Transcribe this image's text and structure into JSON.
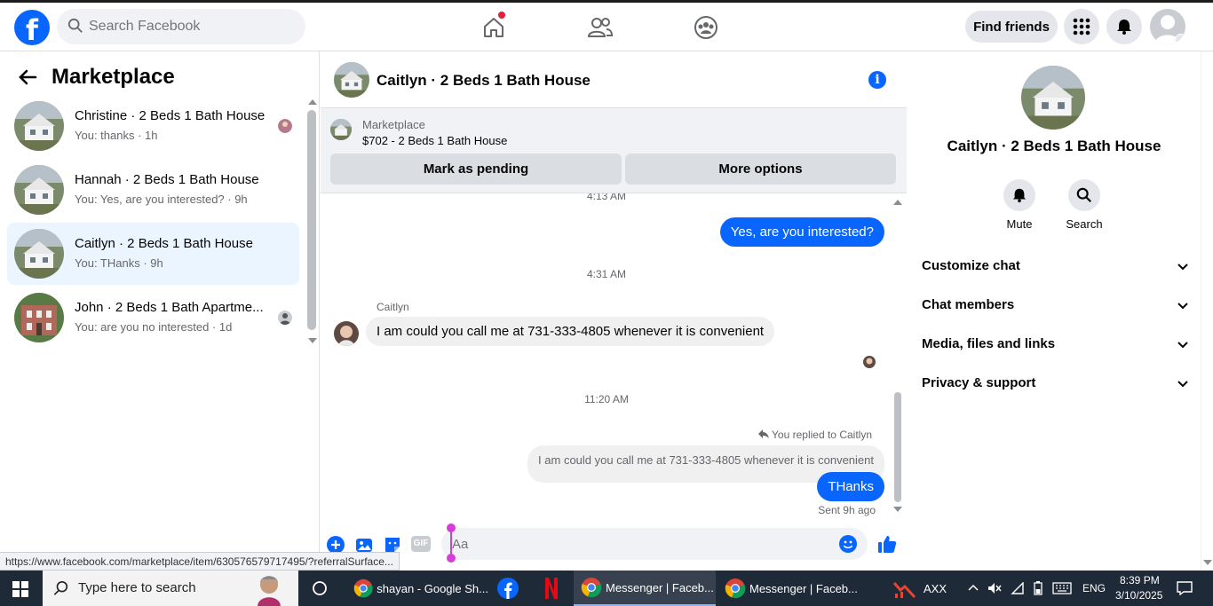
{
  "topbar": {
    "logo_letter": "f",
    "search_placeholder": "Search Facebook",
    "find_friends_label": "Find friends"
  },
  "left": {
    "title": "Marketplace",
    "conversations": [
      {
        "name": "Christine · 2 Beds 1 Bath House",
        "snippet": "You: thanks · 1h"
      },
      {
        "name": "Hannah · 2 Beds 1 Bath House",
        "snippet": "You: Yes, are you interested? · 9h"
      },
      {
        "name": "Caitlyn · 2 Beds 1 Bath House",
        "snippet": "You: THanks · 9h"
      },
      {
        "name": "John · 2 Beds 1 Bath Apartme...",
        "snippet": "You: are you no interested · 1d"
      }
    ]
  },
  "chat": {
    "title": "Caitlyn · 2 Beds 1 Bath House",
    "marketplace_label": "Marketplace",
    "listing_price": "$702 - 2 Beds 1 Bath House",
    "mark_pending_label": "Mark as pending",
    "more_options_label": "More options",
    "time_partial": "4:13 AM",
    "msg_out_1": "Yes, are you interested?",
    "time_2": "4:31 AM",
    "sender_name": "Caitlyn",
    "msg_in_1": "I am could you call me at 731-333-4805 whenever it is convenient",
    "time_3": "11:20 AM",
    "replied_label": "You replied to Caitlyn",
    "reply_quote": "I am could you call me at 731-333-4805 whenever it is convenient",
    "msg_out_2": "THanks",
    "sent_status": "Sent 9h ago",
    "composer_placeholder": "Aa",
    "gif_label": "GIF"
  },
  "right": {
    "name": "Caitlyn · 2 Beds 1 Bath House",
    "mute_label": "Mute",
    "search_label": "Search",
    "sections": [
      "Customize chat",
      "Chat members",
      "Media, files and links",
      "Privacy & support"
    ]
  },
  "status_url": "https://www.facebook.com/marketplace/item/630576579717495/?referralSurface...",
  "taskbar": {
    "search_placeholder": "Type here to search",
    "items": [
      "shayan - Google Sh...",
      "Messenger | Faceb...",
      "Messenger | Faceb..."
    ],
    "tray_app": "AXX",
    "lang": "ENG",
    "time": "8:39 PM",
    "date": "3/10/2025"
  },
  "colors": {
    "brand_blue": "#0866ff",
    "active_conv_bg": "#ebf5ff",
    "taskbar_bg": "#1f2a38"
  }
}
